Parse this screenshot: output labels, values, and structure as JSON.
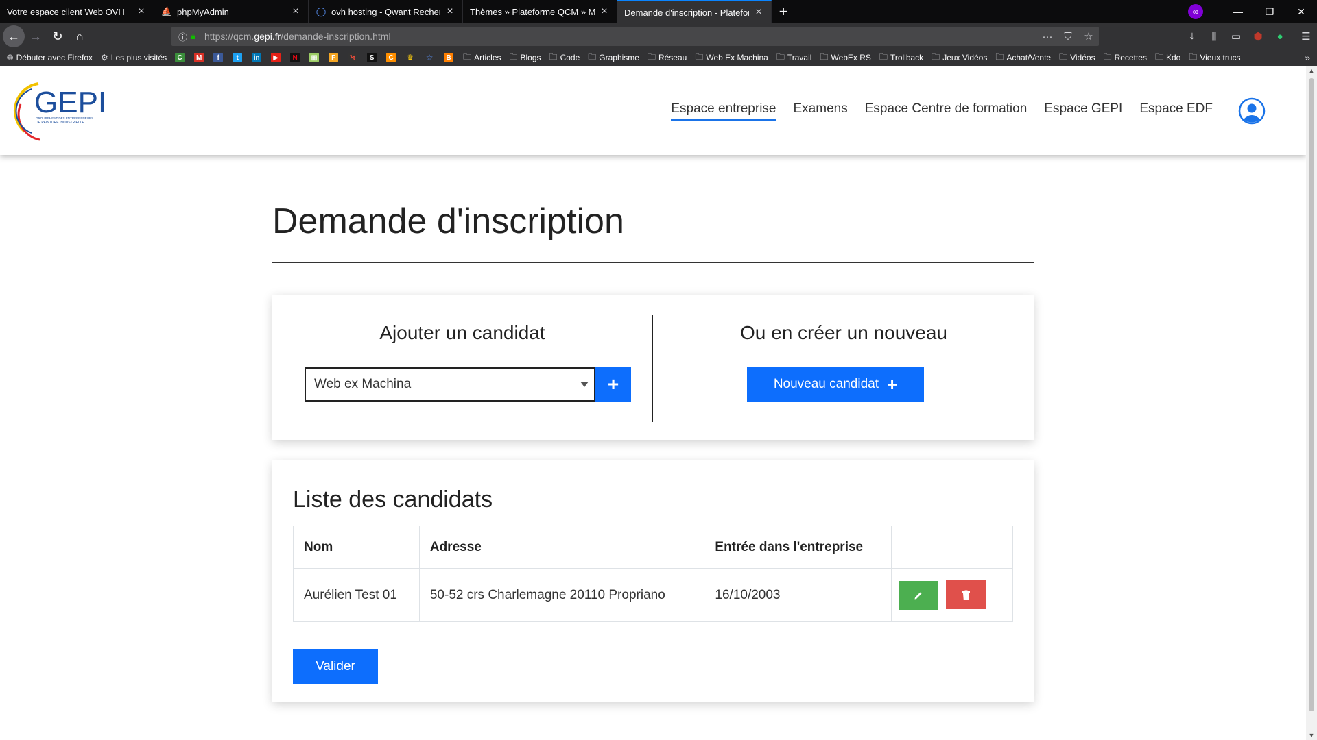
{
  "browser": {
    "tabs": [
      {
        "title": "Votre espace client Web OVH",
        "active": false
      },
      {
        "title": "phpMyAdmin",
        "active": false
      },
      {
        "title": "ovh hosting - Qwant Recherche",
        "active": false
      },
      {
        "title": "Thèmes » Plateforme QCM » Modu",
        "active": false
      },
      {
        "title": "Demande d'inscription - Plateform",
        "active": true
      }
    ],
    "url_prefix": "https://qcm.",
    "url_domain": "gepi.fr",
    "url_path": "/demande-inscription.html",
    "bookmarks": [
      "Débuter avec Firefox",
      "Les plus visités",
      "Articles",
      "Blogs",
      "Code",
      "Graphisme",
      "Réseau",
      "Web Ex Machina",
      "Travail",
      "WebEx RS",
      "Trollback",
      "Jeux Vidéos",
      "Achat/Vente",
      "Vidéos",
      "Recettes",
      "Kdo",
      "Vieux trucs"
    ]
  },
  "site": {
    "logo_text": "GEPI",
    "logo_subtitle_1": "GROUPEMENT DES ENTREPRENEURS",
    "logo_subtitle_2": "DE PEINTURE INDUSTRIELLE",
    "menu": [
      {
        "label": "Espace entreprise",
        "active": true
      },
      {
        "label": "Examens",
        "active": false
      },
      {
        "label": "Espace Centre de formation",
        "active": false
      },
      {
        "label": "Espace GEPI",
        "active": false
      },
      {
        "label": "Espace EDF",
        "active": false
      }
    ]
  },
  "page": {
    "title": "Demande d'inscription",
    "add_section": {
      "heading": "Ajouter un candidat",
      "select_value": "Web ex Machina",
      "add_button": "+"
    },
    "create_section": {
      "heading": "Ou en créer un nouveau",
      "button_label": "Nouveau candidat",
      "button_icon": "+"
    },
    "list_section": {
      "heading": "Liste des candidats",
      "columns": [
        "Nom",
        "Adresse",
        "Entrée dans l'entreprise",
        ""
      ],
      "rows": [
        {
          "nom": "Aurélien Test 01",
          "adresse": "50-52 crs Charlemagne 20110 Propriano",
          "entree": "16/10/2003"
        }
      ],
      "submit_label": "Valider"
    }
  },
  "colors": {
    "primary": "#0d6efd",
    "edit": "#4caf50",
    "delete": "#e0504b",
    "active_menu_underline": "#1a73e8"
  }
}
